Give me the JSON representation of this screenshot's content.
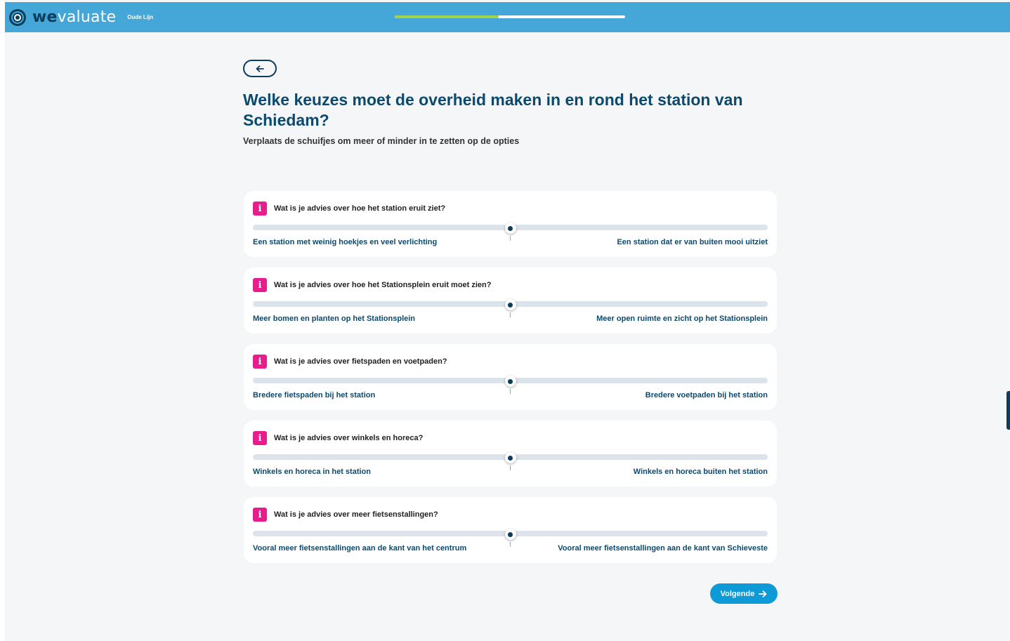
{
  "header": {
    "logo_bold": "we",
    "logo_rest": "valuate",
    "project_name": "Oude Lijn",
    "progress_fraction": 0.45,
    "colors": {
      "bar": "#45a6d8",
      "progress": "#9ed34a"
    }
  },
  "page": {
    "back_icon": "arrow-left-icon",
    "title": "Welke keuzes moet de overheid maken in en rond het station van Schiedam?",
    "subtitle": "Verplaats de schuifjes om meer of minder in te zetten op de opties"
  },
  "sliders": [
    {
      "question": "Wat is je advies over hoe het station eruit ziet?",
      "left_label": "Een station met weinig hoekjes en veel verlichting",
      "right_label": "Een station dat er van buiten mooi uitziet",
      "value": 0.5
    },
    {
      "question": "Wat is je advies over hoe het Stationsplein eruit moet zien?",
      "left_label": "Meer bomen en planten op het Stationsplein",
      "right_label": "Meer open ruimte en zicht op het Stationsplein",
      "value": 0.5
    },
    {
      "question": "Wat is je advies over fietspaden en voetpaden?",
      "left_label": "Bredere fietspaden bij het station",
      "right_label": "Bredere voetpaden bij het station",
      "value": 0.5
    },
    {
      "question": "Wat is je advies over winkels en horeca?",
      "left_label": "Winkels en horeca in het station",
      "right_label": "Winkels en horeca buiten het station",
      "value": 0.5
    },
    {
      "question": "Wat is je advies over meer fietsenstallingen?",
      "left_label": "Vooral meer fietsenstallingen aan de kant van het centrum",
      "right_label": "Vooral meer fietsenstallingen aan de kant van Schieveste",
      "value": 0.5
    }
  ],
  "footer": {
    "next_label": "Volgende",
    "next_icon": "arrow-right-icon",
    "accent_color": "#0e9ad6"
  }
}
